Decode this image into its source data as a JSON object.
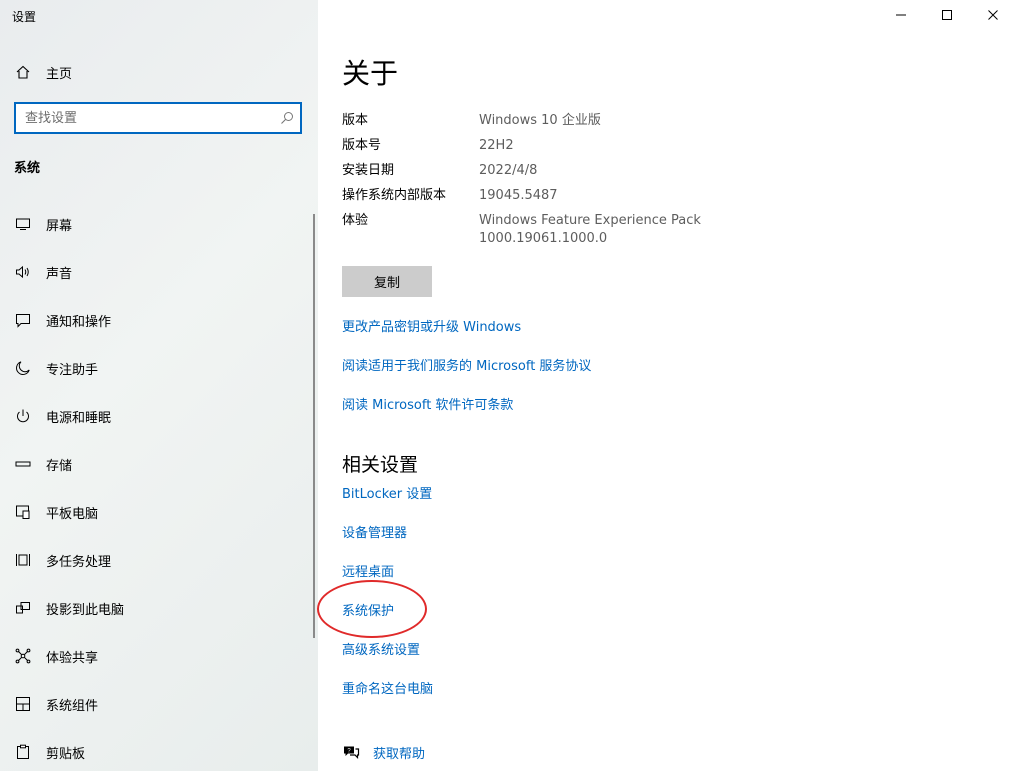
{
  "app": {
    "title": "设置"
  },
  "sidebar": {
    "home": {
      "label": "主页",
      "icon": "home-icon"
    },
    "search": {
      "placeholder": "查找设置"
    },
    "section": "系统",
    "items": [
      {
        "label": "屏幕",
        "icon": "display-icon"
      },
      {
        "label": "声音",
        "icon": "speaker-icon"
      },
      {
        "label": "通知和操作",
        "icon": "notification-icon"
      },
      {
        "label": "专注助手",
        "icon": "moon-icon"
      },
      {
        "label": "电源和睡眠",
        "icon": "power-icon"
      },
      {
        "label": "存储",
        "icon": "storage-icon"
      },
      {
        "label": "平板电脑",
        "icon": "tablet-icon"
      },
      {
        "label": "多任务处理",
        "icon": "multitask-icon"
      },
      {
        "label": "投影到此电脑",
        "icon": "project-icon"
      },
      {
        "label": "体验共享",
        "icon": "share-icon"
      },
      {
        "label": "系统组件",
        "icon": "components-icon"
      },
      {
        "label": "剪贴板",
        "icon": "clipboard-icon"
      }
    ]
  },
  "main": {
    "title": "关于",
    "specs": [
      {
        "key": "版本",
        "value": "Windows 10 企业版"
      },
      {
        "key": "版本号",
        "value": "22H2"
      },
      {
        "key": "安装日期",
        "value": "2022/4/8"
      },
      {
        "key": "操作系统内部版本",
        "value": "19045.5487"
      },
      {
        "key": "体验",
        "value": "Windows Feature Experience Pack",
        "value2": "1000.19061.1000.0"
      }
    ],
    "copy_label": "复制",
    "links": [
      "更改产品密钥或升级 Windows",
      "阅读适用于我们服务的 Microsoft 服务协议",
      "阅读 Microsoft 软件许可条款"
    ],
    "related_title": "相关设置",
    "related_links": [
      "BitLocker 设置",
      "设备管理器",
      "远程桌面",
      "系统保护",
      "高级系统设置",
      "重命名这台电脑"
    ],
    "help_label": "获取帮助"
  },
  "colors": {
    "accent": "#0067c0",
    "annotation": "#e02a2a",
    "button_bg": "#cccccc"
  }
}
